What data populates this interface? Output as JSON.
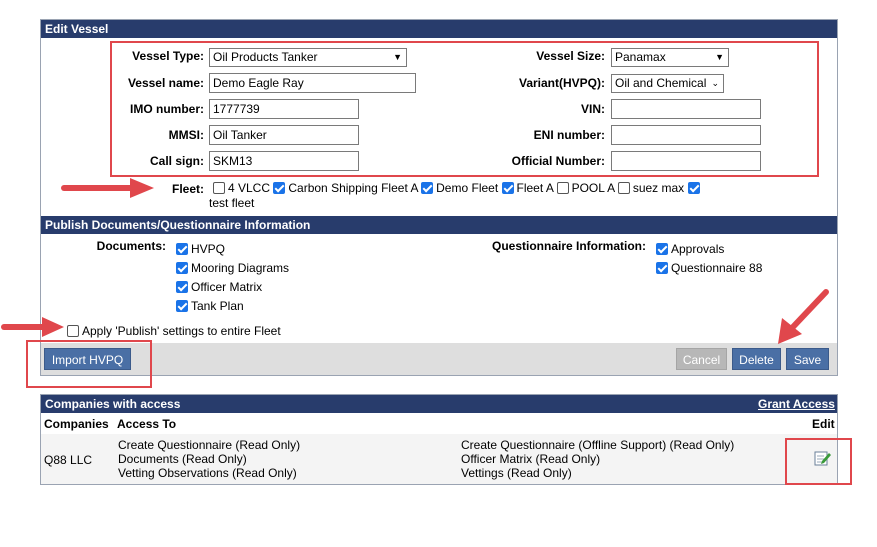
{
  "edit_vessel": {
    "title": "Edit Vessel",
    "vessel_type": {
      "label": "Vessel Type:",
      "value": "Oil Products Tanker"
    },
    "vessel_name": {
      "label": "Vessel name:",
      "value": "Demo Eagle Ray"
    },
    "imo_number": {
      "label": "IMO number:",
      "value": "1777739"
    },
    "mmsi": {
      "label": "MMSI:",
      "value": "Oil Tanker"
    },
    "call_sign": {
      "label": "Call sign:",
      "value": "SKM13"
    },
    "vessel_size": {
      "label": "Vessel Size:",
      "value": "Panamax"
    },
    "variant": {
      "label": "Variant(HVPQ):",
      "value": "Oil and Chemical"
    },
    "vin": {
      "label": "VIN:",
      "value": ""
    },
    "eni_number": {
      "label": "ENI number:",
      "value": ""
    },
    "official_number": {
      "label": "Official Number:",
      "value": ""
    },
    "fleet": {
      "label": "Fleet:",
      "items": [
        {
          "label": "4 VLCC",
          "checked": false
        },
        {
          "label": "Carbon Shipping Fleet A",
          "checked": true
        },
        {
          "label": "Demo Fleet",
          "checked": true
        },
        {
          "label": "Fleet A",
          "checked": true
        },
        {
          "label": "POOL A",
          "checked": false
        },
        {
          "label": "suez max",
          "checked": false
        },
        {
          "label": "test fleet",
          "checked": true
        }
      ]
    }
  },
  "publish": {
    "title": "Publish Documents/Questionnaire Information",
    "documents_label": "Documents:",
    "documents": [
      {
        "label": "HVPQ",
        "checked": true
      },
      {
        "label": "Mooring Diagrams",
        "checked": true
      },
      {
        "label": "Officer Matrix",
        "checked": true
      },
      {
        "label": "Tank Plan",
        "checked": true
      }
    ],
    "questionnaire_label": "Questionnaire Information:",
    "questionnaires": [
      {
        "label": "Approvals",
        "checked": true
      },
      {
        "label": "Questionnaire 88",
        "checked": true
      }
    ],
    "apply_fleet": {
      "label": "Apply 'Publish' settings to entire Fleet",
      "checked": false
    }
  },
  "buttons": {
    "import": "Import HVPQ",
    "cancel": "Cancel",
    "delete": "Delete",
    "save": "Save"
  },
  "companies": {
    "title": "Companies with access",
    "grant_access": "Grant Access",
    "col_companies": "Companies",
    "col_access": "Access To",
    "col_edit": "Edit",
    "rows": [
      {
        "company": "Q88 LLC",
        "access_left": [
          "Create Questionnaire (Read Only)",
          "Documents (Read Only)",
          "Vetting Observations (Read Only)"
        ],
        "access_right": [
          "Create Questionnaire (Offline Support) (Read Only)",
          "Officer Matrix (Read Only)",
          "Vettings (Read Only)"
        ]
      }
    ]
  },
  "colors": {
    "header": "#283c6c",
    "button_blue": "#4a6fa5",
    "highlight_red": "#e0474c",
    "checkbox_blue": "#1a73e8"
  }
}
